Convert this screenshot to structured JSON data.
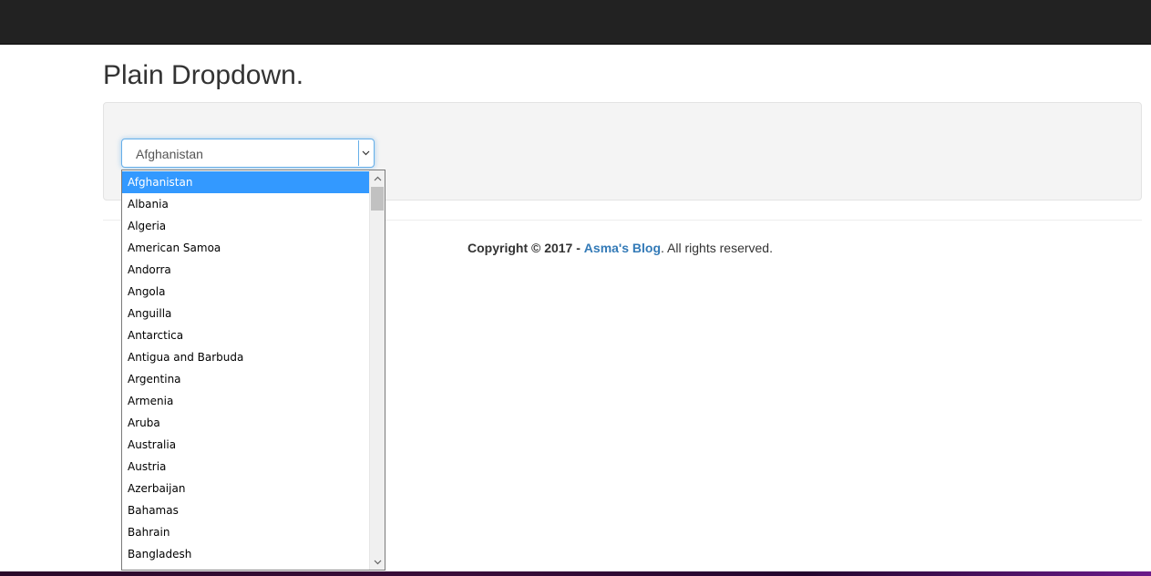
{
  "page": {
    "title": "Plain Dropdown."
  },
  "select": {
    "value": "Afghanistan",
    "arrow_icon": "chevron-down-icon",
    "options": [
      "Afghanistan",
      "Albania",
      "Algeria",
      "American Samoa",
      "Andorra",
      "Angola",
      "Anguilla",
      "Antarctica",
      "Antigua and Barbuda",
      "Argentina",
      "Armenia",
      "Aruba",
      "Australia",
      "Austria",
      "Azerbaijan",
      "Bahamas",
      "Bahrain",
      "Bangladesh"
    ],
    "selected_index": 0
  },
  "footer": {
    "copyright": "Copyright © 2017 -",
    "link": "Asma's Blog",
    "suffix": ". All rights reserved."
  },
  "colors": {
    "topbar": "#222222",
    "highlight": "#3399ff",
    "link": "#337ab7",
    "focus": "#66afe9"
  }
}
